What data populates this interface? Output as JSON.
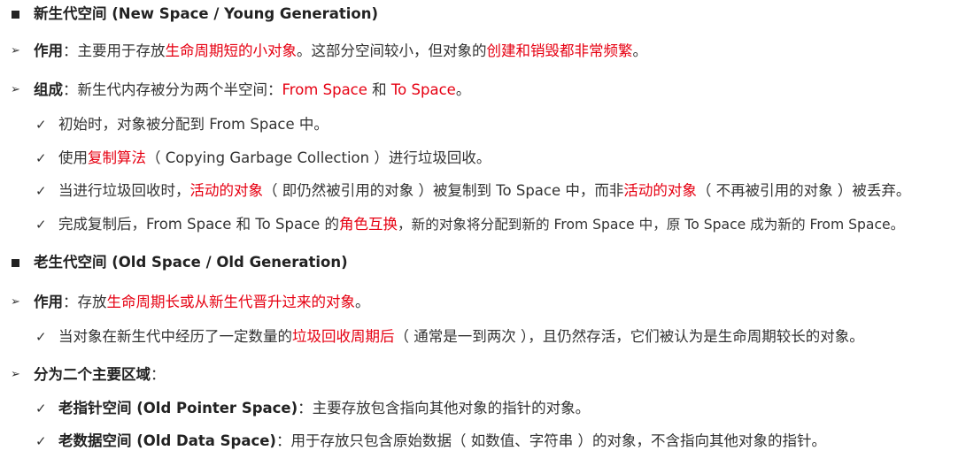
{
  "sections": [
    {
      "heading": "新生代空间 (New Space / Young Generation)",
      "function_label": "作用",
      "function_a": "：主要用于存放",
      "function_b": "生命周期短的小对象",
      "function_c": "。这部分空间较小，但对象的",
      "function_d": "创建和销毁都非常频繁",
      "function_e": "。",
      "composition_label": "组成",
      "composition_a": "：新生代内存被分为两个半空间：",
      "composition_b": "From Space",
      "composition_c": " 和 ",
      "composition_d": "To Space",
      "composition_e": "。",
      "sub1": "初始时，对象被分配到 From Space 中。",
      "sub2_a": "使用",
      "sub2_b": "复制算法",
      "sub2_c": "（ Copying Garbage Collection ）进行垃圾回收。",
      "sub3_a": "当进行垃圾回收时，",
      "sub3_b": "活动的对象",
      "sub3_c": "（ 即仍然被引用的对象 ）被复制到 To Space 中，而非",
      "sub3_d": "活动的对象",
      "sub3_e": "（ 不再被引用的对象 ）被丢弃。",
      "sub4_a": "完成复制后，From Space 和 To Space 的",
      "sub4_b": "角色互换",
      "sub4_c": "，新的对象将分配到新的 From Space 中，原 To Space 成为新的 From Space。"
    },
    {
      "heading": "老生代空间 (Old Space / Old Generation)",
      "function_label": "作用",
      "function_a": "：存放",
      "function_b": "生命周期长或从新生代晋升过来的对象",
      "function_c": "。",
      "sub1_a": "当对象在新生代中经历了一定数量的",
      "sub1_b": "垃圾回收周期后",
      "sub1_c": "（ 通常是一到两次 ），且仍然存活，它们被认为是生命周期较长的对象。",
      "regions_label": "分为二个主要区域",
      "regions_colon": "：",
      "region1_label": "老指针空间 (Old Pointer Space)",
      "region1_text": "：主要存放包含指向其他对象的指针的对象。",
      "region2_label": "老数据空间 (Old Data Space)",
      "region2_text": "：用于存放只包含原始数据（ 如数值、字符串 ）的对象，不含指向其他对象的指针。"
    }
  ],
  "icons": {
    "square": "square-bullet-icon",
    "arrow": "arrow-bullet-icon",
    "check": "check-bullet-icon"
  },
  "colors": {
    "highlight": "#e60012",
    "text": "#333333"
  }
}
